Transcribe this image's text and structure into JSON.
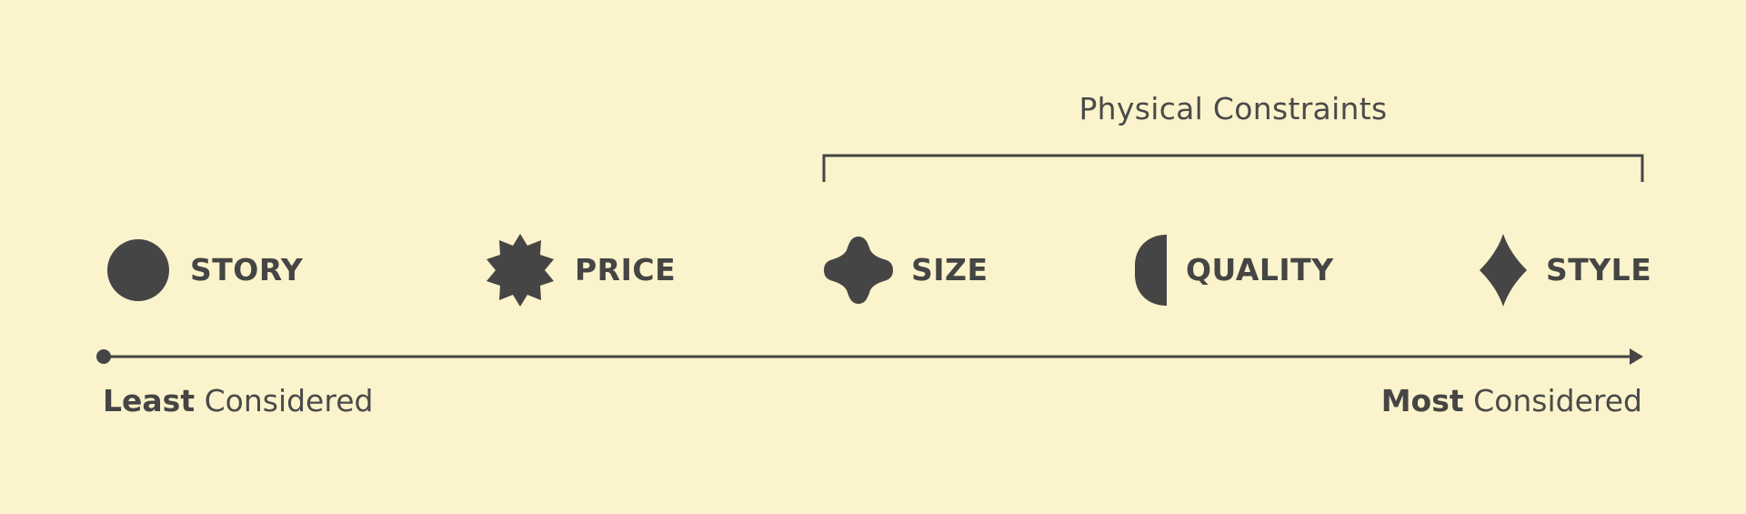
{
  "colors": {
    "background": "#FBF3CB",
    "ink": "#454545"
  },
  "bracket": {
    "label": "Physical Constraints"
  },
  "items": [
    {
      "label": "STORY",
      "icon": "circle-icon"
    },
    {
      "label": "PRICE",
      "icon": "starburst-icon"
    },
    {
      "label": "SIZE",
      "icon": "four-lobed-cross-icon"
    },
    {
      "label": "QUALITY",
      "icon": "half-leaf-icon"
    },
    {
      "label": "STYLE",
      "icon": "concave-diamond-icon"
    }
  ],
  "axis": {
    "start": {
      "bold": "Least",
      "rest": " Considered"
    },
    "end": {
      "bold": "Most",
      "rest": " Considered"
    }
  }
}
